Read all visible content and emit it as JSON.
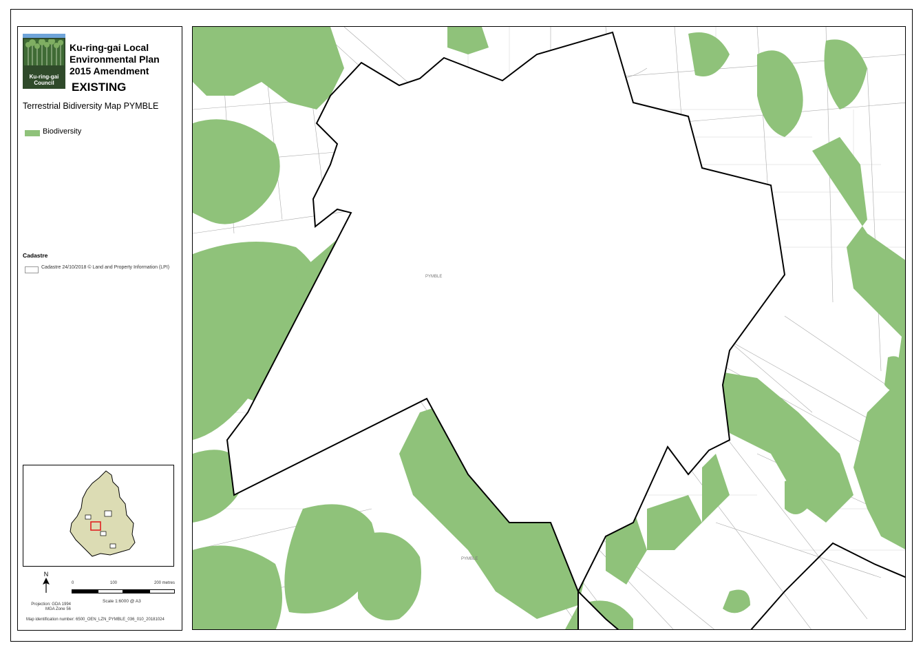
{
  "header": {
    "title": "Ku-ring-gai Local Environmental Plan 2015 Amendment",
    "status": "EXISTING",
    "map_title": "Terrestrial Bidiversity Map PYMBLE",
    "logo_text": "Ku-ring-gai Council"
  },
  "legend": {
    "biodiversity_label": "Biodiversity",
    "cadastre_heading": "Cadastre",
    "cadastre_label": "Cadastre 24/10/2018 © Land and Property Information (LPI)"
  },
  "colors": {
    "biodiversity": "#8fc27a",
    "boundary": "#000000",
    "cadastre": "#9a9a9a",
    "locator_fill": "#dcdcb4"
  },
  "scale": {
    "label": "Scale 1:6000 @ A3",
    "tick_0": "0",
    "tick_mid": "100",
    "tick_end": "200 metres"
  },
  "north": "N",
  "projection": "Projection: GDA 1994 MGA Zone 56",
  "map_id": "Map identification number: 6500_OEN_LZN_PYMBLE_036_010_20181024",
  "map_labels": {
    "center": "PYMBLE",
    "south": "PYMBLE"
  }
}
